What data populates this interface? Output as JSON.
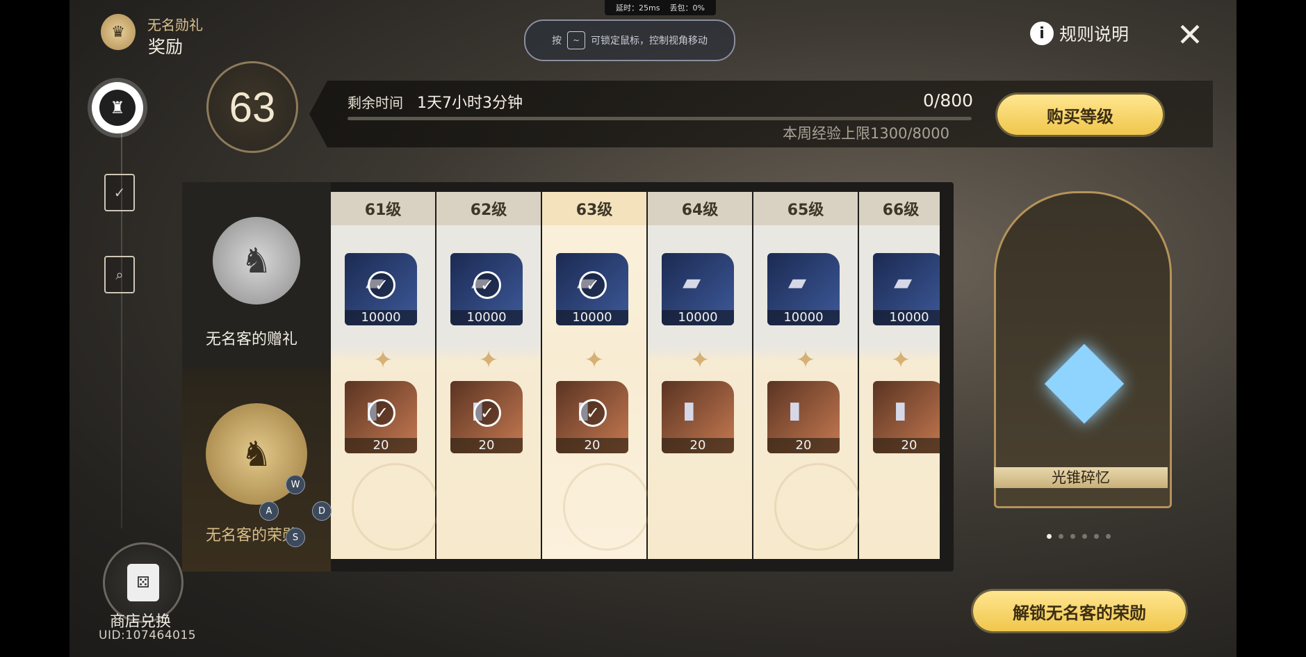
{
  "header": {
    "title_small": "无名勋礼",
    "title_big": "奖励",
    "rules_label": "规则说明",
    "close_label": "✕"
  },
  "latency": {
    "delay": "延时：25ms",
    "loss": "丢包：0%"
  },
  "hint": {
    "prefix": "按",
    "key": "~",
    "text": "可锁定鼠标，控制视角移动"
  },
  "level": {
    "value": "63",
    "remaining_label": "剩余时间",
    "remaining_value": "1天7小时3分钟",
    "exp": "0/800",
    "weekly": "本周经验上限1300/8000",
    "buy_label": "购买等级"
  },
  "tiers": {
    "free_label": "无名客的赠礼",
    "paid_label": "无名客的荣勋"
  },
  "columns": [
    {
      "level": "61级",
      "top_qty": "10000",
      "bottom_qty": "20",
      "claimed": true
    },
    {
      "level": "62级",
      "top_qty": "10000",
      "bottom_qty": "20",
      "claimed": true
    },
    {
      "level": "63级",
      "top_qty": "10000",
      "bottom_qty": "20",
      "claimed": true
    },
    {
      "level": "64级",
      "top_qty": "10000",
      "bottom_qty": "20",
      "claimed": false
    },
    {
      "level": "65级",
      "top_qty": "10000",
      "bottom_qty": "20",
      "claimed": false
    },
    {
      "level": "66级",
      "top_qty": "10000",
      "bottom_qty": "20",
      "claimed": false
    }
  ],
  "wasd": {
    "w": "W",
    "a": "A",
    "s": "S",
    "d": "D"
  },
  "showcase": {
    "label": "光锥碎忆",
    "page_count": 6,
    "current_page": 1
  },
  "unlock_label": "解锁无名客的荣勋",
  "shop": {
    "label": "商店兑换",
    "uid": "UID:107464015"
  },
  "colors": {
    "gold": "#f0c64c",
    "panel": "#1c1b19"
  }
}
